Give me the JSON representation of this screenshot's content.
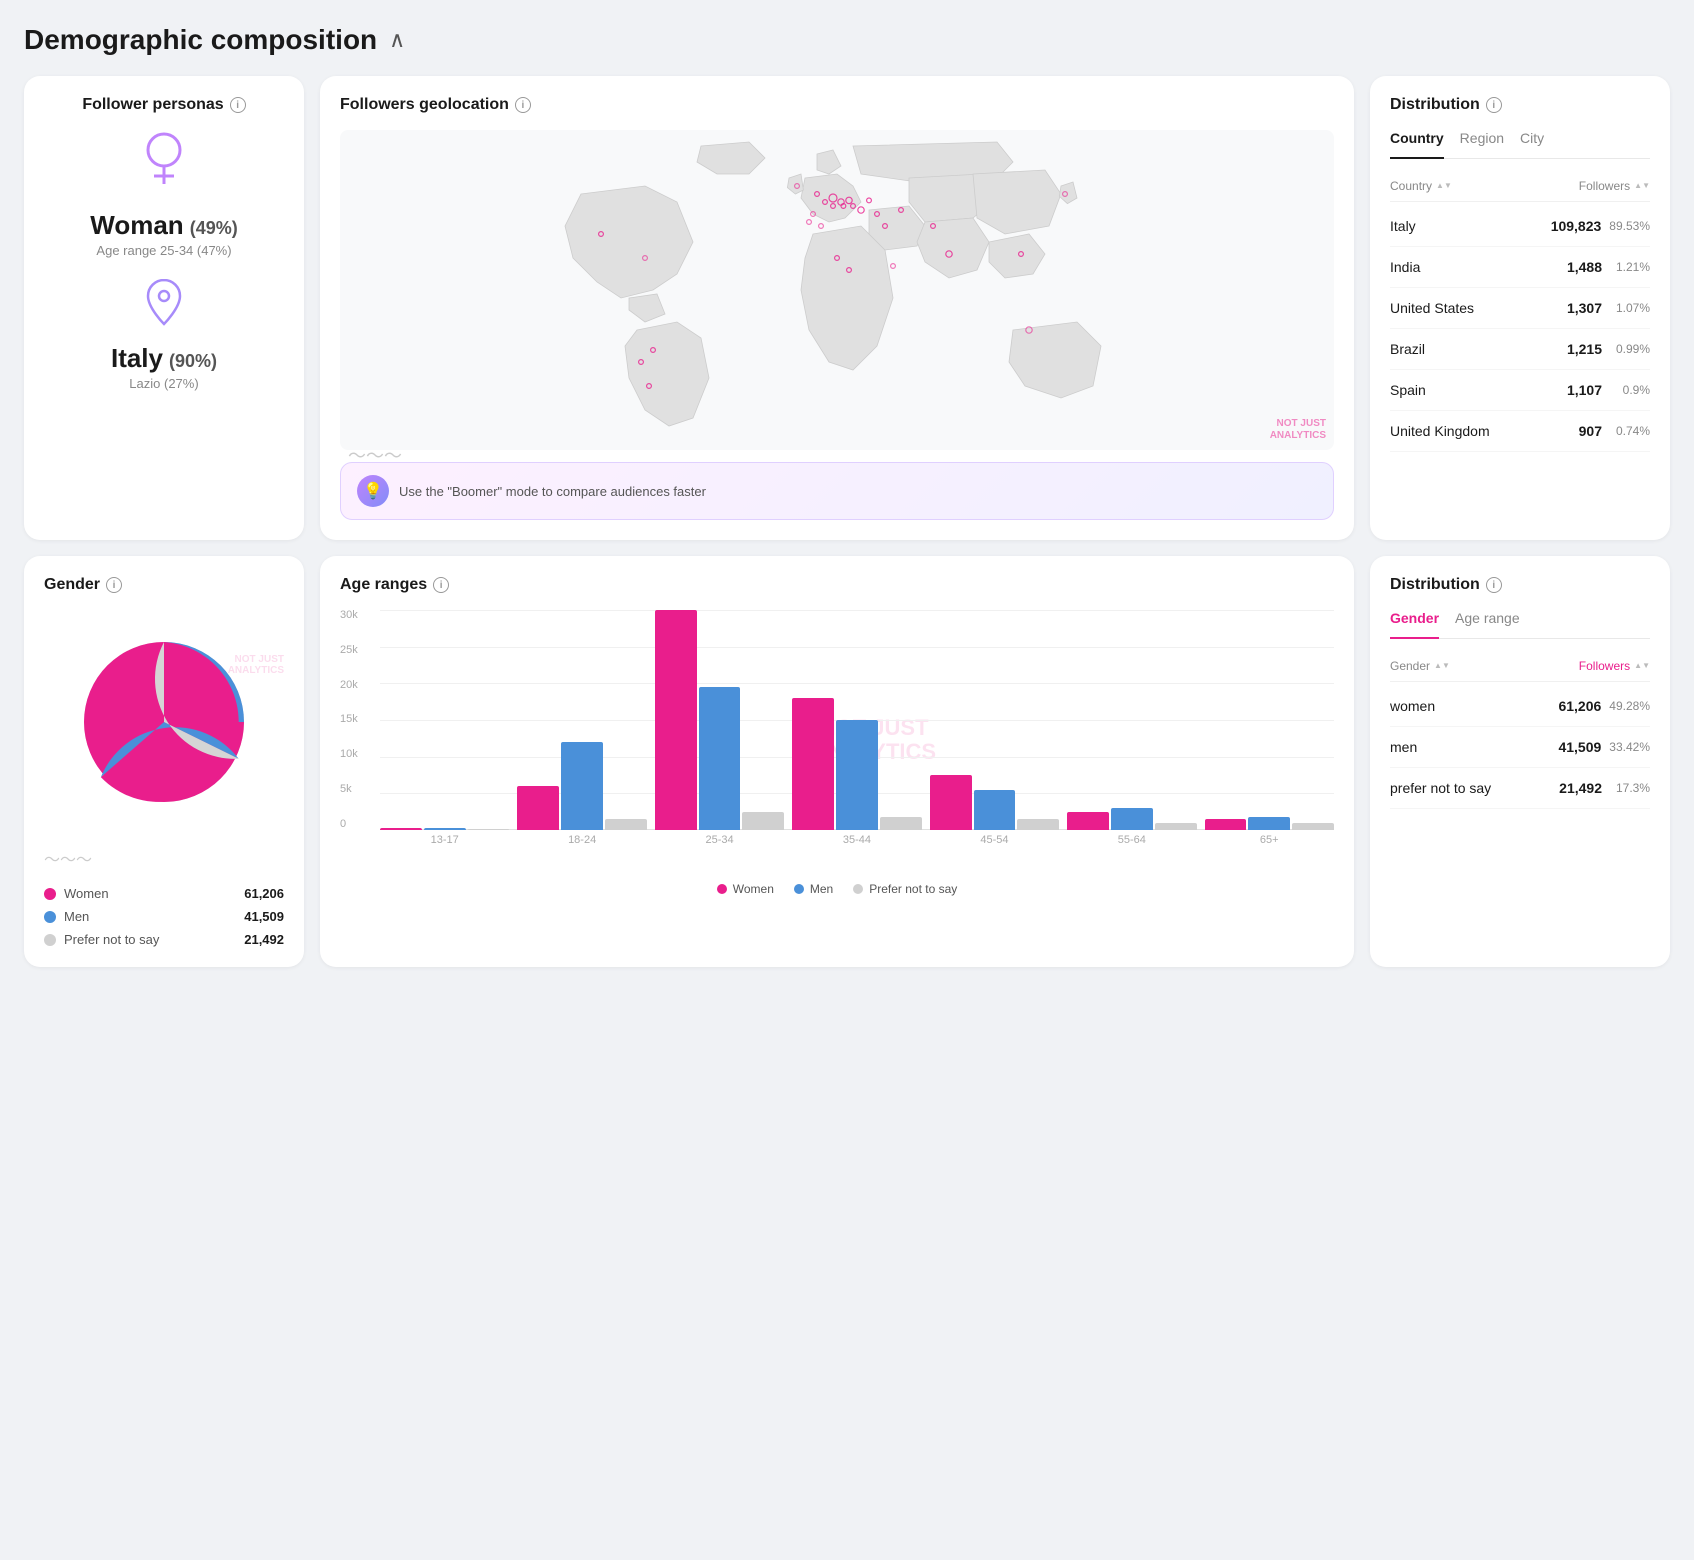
{
  "page": {
    "title": "Demographic composition",
    "chevron": "∧"
  },
  "follower_personas": {
    "title": "Follower personas",
    "gender": {
      "label": "Woman",
      "pct": "(49%)",
      "sub": "Age range 25-34 (47%)"
    },
    "location": {
      "label": "Italy",
      "pct": "(90%)",
      "sub": "Lazio (27%)"
    }
  },
  "geolocation": {
    "title": "Followers geolocation",
    "watermark_line1": "NOT JUST",
    "watermark_line2": "ANALYTICS",
    "boomer_text": "Use the \"Boomer\" mode to compare audiences faster"
  },
  "distribution_country": {
    "title": "Distribution",
    "tabs": [
      "Country",
      "Region",
      "City"
    ],
    "active_tab": "Country",
    "col_country": "Country",
    "col_followers": "Followers",
    "rows": [
      {
        "name": "Italy",
        "value": "109,823",
        "pct": "89.53%"
      },
      {
        "name": "India",
        "value": "1,488",
        "pct": "1.21%"
      },
      {
        "name": "United States",
        "value": "1,307",
        "pct": "1.07%"
      },
      {
        "name": "Brazil",
        "value": "1,215",
        "pct": "0.99%"
      },
      {
        "name": "Spain",
        "value": "1,107",
        "pct": "0.9%"
      },
      {
        "name": "United Kingdom",
        "value": "907",
        "pct": "0.74%"
      }
    ]
  },
  "gender": {
    "title": "Gender",
    "pie": {
      "women_pct": 49,
      "men_pct": 34,
      "other_pct": 17
    },
    "legend": [
      {
        "label": "Women",
        "value": "61,206",
        "color": "#e91e8c"
      },
      {
        "label": "Men",
        "value": "41,509",
        "color": "#4a90d9"
      },
      {
        "label": "Prefer not to say",
        "value": "21,492",
        "color": "#d0d0d0"
      }
    ],
    "watermark_line1": "NOT JUST",
    "watermark_line2": "ANALYTICS"
  },
  "age_ranges": {
    "title": "Age ranges",
    "y_labels": [
      "0",
      "5k",
      "10k",
      "15k",
      "20k",
      "25k",
      "30k"
    ],
    "groups": [
      {
        "label": "13-17",
        "women": 1,
        "men": 1,
        "other": 0.5
      },
      {
        "label": "18-24",
        "women": 20,
        "men": 40,
        "other": 5
      },
      {
        "label": "25-34",
        "women": 100,
        "men": 65,
        "other": 8
      },
      {
        "label": "35-44",
        "women": 60,
        "men": 50,
        "other": 6
      },
      {
        "label": "45-54",
        "women": 25,
        "men": 18,
        "other": 5
      },
      {
        "label": "55-64",
        "women": 8,
        "men": 10,
        "other": 3
      },
      {
        "label": "65+",
        "women": 5,
        "men": 6,
        "other": 3
      }
    ],
    "legend": [
      {
        "label": "Women",
        "color": "#e91e8c"
      },
      {
        "label": "Men",
        "color": "#4a90d9"
      },
      {
        "label": "Prefer not to say",
        "color": "#d0d0d0"
      }
    ],
    "watermark_line1": "NOT JUST",
    "watermark_line2": "ANALYTICS"
  },
  "distribution_gender": {
    "title": "Distribution",
    "tabs": [
      "Gender",
      "Age range"
    ],
    "active_tab": "Gender",
    "col_gender": "Gender",
    "col_followers": "Followers",
    "rows": [
      {
        "name": "women",
        "value": "61,206",
        "pct": "49.28%"
      },
      {
        "name": "men",
        "value": "41,509",
        "pct": "33.42%"
      },
      {
        "name": "prefer not to say",
        "value": "21,492",
        "pct": "17.3%"
      }
    ]
  }
}
